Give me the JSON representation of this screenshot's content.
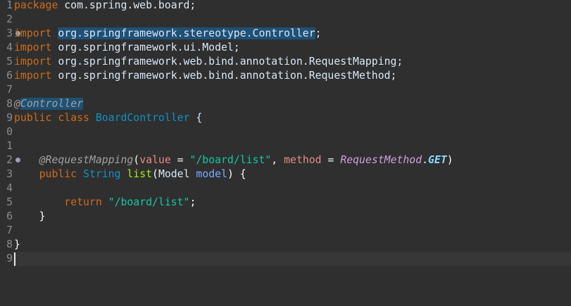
{
  "editor": {
    "colors": {
      "background": "#2f2f2f",
      "current_line": "#373737",
      "keyword": "#cc6c1d",
      "string": "#17c6a3",
      "selection": "#1f5075"
    },
    "line_numbers": [
      "1",
      "2",
      "3",
      "4",
      "5",
      "6",
      "7",
      "8",
      "9",
      "0",
      "1",
      "2",
      "3",
      "4",
      "5",
      "6",
      "7",
      "8",
      "9"
    ],
    "fold_markers_on": [
      "3",
      "12"
    ],
    "lines": {
      "l1": {
        "kw": "package",
        "rest": " com.spring.web.board;"
      },
      "l3": {
        "kw": "import",
        "sp": " ",
        "hl": "org.springframework.stereotype.Controller",
        "rest": ";"
      },
      "l4": {
        "kw": "import",
        "rest": " org.springframework.ui.Model;"
      },
      "l5": {
        "kw": "import",
        "rest": " org.springframework.web.bind.annotation.RequestMapping;"
      },
      "l6": {
        "kw": "import",
        "rest": " org.springframework.web.bind.annotation.RequestMethod;"
      },
      "l8": {
        "at": "@",
        "hl": "Controller"
      },
      "l9": {
        "kw1": "public",
        "kw2": "class",
        "cls": "BoardController",
        "rest": " {"
      },
      "l12": {
        "ann": "@RequestMapping",
        "p1": "(",
        "attr1": "value",
        "eq1": " = ",
        "str": "\"/board/list\"",
        "comma": ", ",
        "attr2": "method",
        "eq2": " = ",
        "enumtype": "RequestMethod",
        "dot": ".",
        "enumconst": "GET",
        "p2": ")"
      },
      "l13": {
        "kw": "public",
        "type": "String",
        "name": "list",
        "p1": "(",
        "ptype": "Model",
        "pname": "model",
        "rest": ") {"
      },
      "l15": {
        "kw": "return",
        "str": "\"/board/list\"",
        "rest": ";"
      },
      "l16": {
        "rest": "}"
      },
      "l18": {
        "rest": "}"
      }
    }
  }
}
